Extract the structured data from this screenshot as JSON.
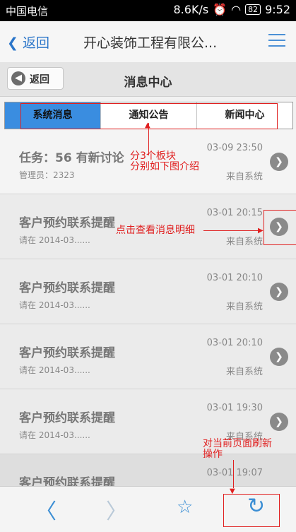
{
  "status_bar": {
    "carrier": "中国电信",
    "speed": "8.6K/s",
    "battery": "82",
    "time": "9:52"
  },
  "nav": {
    "back_label": "返回",
    "title": "开心装饰工程有限公...",
    "menu_icon": "list-menu-icon"
  },
  "header": {
    "back_label": "返回",
    "title": "消息中心"
  },
  "tabs": [
    {
      "label": "系统消息",
      "active": true
    },
    {
      "label": "通知公告",
      "active": false
    },
    {
      "label": "新闻中心",
      "active": false
    }
  ],
  "messages": [
    {
      "title": "任务：56 有新讨论",
      "sub": "管理员：2323",
      "time": "03-09 23:50",
      "source": "来自系统"
    },
    {
      "title": "客户预约联系提醒",
      "sub": "请在 2014-03......",
      "time": "03-01 20:15",
      "source": "来自系统"
    },
    {
      "title": "客户预约联系提醒",
      "sub": "请在 2014-03......",
      "time": "03-01 20:10",
      "source": "来自系统"
    },
    {
      "title": "客户预约联系提醒",
      "sub": "请在 2014-03......",
      "time": "03-01 20:10",
      "source": "来自系统"
    },
    {
      "title": "客户预约联系提醒",
      "sub": "请在 2014-03......",
      "time": "03-01 19:30",
      "source": "来自系统"
    },
    {
      "title": "客户预约联系提醒",
      "sub": "",
      "time": "03-01 19:07",
      "source": ""
    }
  ],
  "annotations": {
    "tabs_note_line1": "分3个板块",
    "tabs_note_line2": "分别如下图介绍",
    "detail_note": "点击查看消息明细",
    "refresh_note_line1": "对当前页面刷新",
    "refresh_note_line2": "操作"
  },
  "colors": {
    "accent": "#3a8de0",
    "annotation": "#e02020"
  }
}
